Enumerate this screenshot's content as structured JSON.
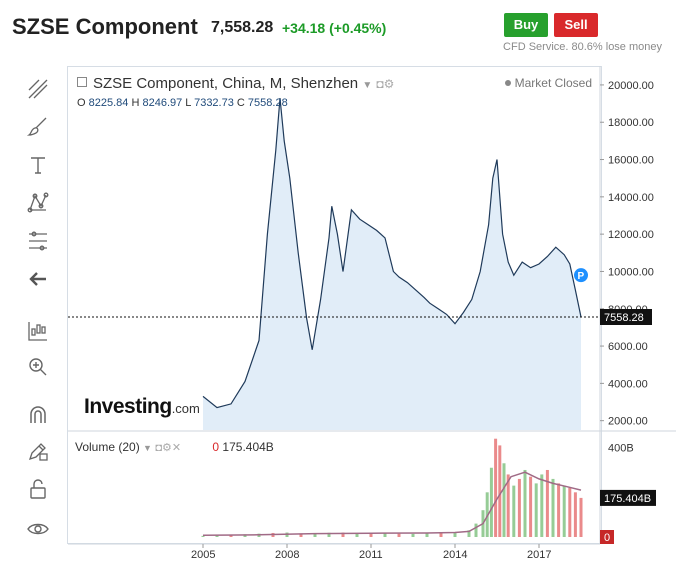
{
  "header": {
    "instrument_name": "SZSE Component",
    "price": "7,558.28",
    "change": "+34.18 (+0.45%)",
    "buy_label": "Buy",
    "sell_label": "Sell",
    "cfd_note": "CFD Service. 80.6% lose money"
  },
  "chart_header": {
    "title": "SZSE Component, China, M, Shenzhen",
    "market_status": "Market Closed",
    "open_label": "O",
    "open": "8225.84",
    "high_label": "H",
    "high": "8246.97",
    "low_label": "L",
    "low": "7332.73",
    "close_label": "C",
    "close": "7558.28"
  },
  "volume_header": {
    "label": "Volume (20)",
    "value_zero": "0",
    "value": "175.404B"
  },
  "toolbar_icons": [
    "crosshair-lines-icon",
    "brush-icon",
    "text-icon",
    "pattern-icon",
    "fib-levels-icon",
    "back-arrow-icon",
    "indicators-icon",
    "zoom-icon",
    "magnet-icon",
    "edit-lock-icon",
    "unlock-icon",
    "eye-icon"
  ],
  "logo_text": "Investing",
  "logo_suffix": ".com",
  "colors": {
    "line": "#1f3a5a",
    "area": "#dceaf7",
    "up": "#3fa33f",
    "down": "#d9292b",
    "buy": "#27a02d",
    "sell": "#d9292b",
    "badge": "#1e90ff"
  },
  "chart_data": [
    {
      "type": "area",
      "x_tick_labels": [
        "2005",
        "2008",
        "2011",
        "2014",
        "2017"
      ],
      "y_tick_labels": [
        "2000.00",
        "4000.00",
        "6000.00",
        "8000.00",
        "10000.00",
        "12000.00",
        "14000.00",
        "16000.00",
        "18000.00",
        "20000.00"
      ],
      "ylim": [
        1500,
        20800
      ],
      "xlim": [
        2005.9,
        2018.5
      ],
      "last_value": 7558.28,
      "last_value_label": "7558.28",
      "badge": "P",
      "x": [
        2005.0,
        2005.5,
        2006.0,
        2006.5,
        2007.0,
        2007.3,
        2007.6,
        2007.75,
        2007.9,
        2008.1,
        2008.4,
        2008.7,
        2008.9,
        2009.2,
        2009.5,
        2009.6,
        2009.8,
        2010.0,
        2010.3,
        2010.6,
        2010.9,
        2011.2,
        2011.5,
        2011.8,
        2012.0,
        2012.3,
        2012.6,
        2012.9,
        2013.1,
        2013.4,
        2013.7,
        2014.0,
        2014.3,
        2014.6,
        2014.9,
        2015.2,
        2015.35,
        2015.5,
        2015.7,
        2015.9,
        2016.1,
        2016.4,
        2016.7,
        2017.0,
        2017.3,
        2017.6,
        2017.9,
        2018.1,
        2018.3,
        2018.5
      ],
      "values": [
        3300,
        2700,
        2900,
        4100,
        6300,
        12000,
        16500,
        19300,
        17000,
        15000,
        11000,
        7500,
        5800,
        8500,
        11800,
        13500,
        12000,
        10000,
        13300,
        12800,
        12500,
        12200,
        11800,
        10000,
        9700,
        9400,
        9000,
        8600,
        8300,
        8000,
        7700,
        7200,
        7800,
        8500,
        10000,
        12500,
        15000,
        16000,
        12000,
        10500,
        9800,
        10500,
        10200,
        10400,
        10800,
        11300,
        10900,
        10400,
        9000,
        7558
      ]
    },
    {
      "type": "bar",
      "name": "Volume (20)",
      "ylabels": [
        "400B"
      ],
      "ylim": [
        0,
        470
      ],
      "last_value_label": "175.404B",
      "zero_label": "0",
      "x": [
        2005.0,
        2005.5,
        2006.0,
        2006.5,
        2007.0,
        2007.5,
        2008.0,
        2008.5,
        2009.0,
        2009.5,
        2010.0,
        2010.5,
        2011.0,
        2011.5,
        2012.0,
        2012.5,
        2013.0,
        2013.5,
        2014.0,
        2014.5,
        2014.75,
        2015.0,
        2015.15,
        2015.3,
        2015.45,
        2015.6,
        2015.75,
        2015.9,
        2016.1,
        2016.3,
        2016.5,
        2016.7,
        2016.9,
        2017.1,
        2017.3,
        2017.5,
        2017.7,
        2017.9,
        2018.1,
        2018.3,
        2018.5
      ],
      "values": [
        5,
        6,
        8,
        12,
        15,
        18,
        20,
        16,
        17,
        19,
        20,
        18,
        17,
        16,
        15,
        14,
        18,
        20,
        22,
        30,
        60,
        120,
        200,
        310,
        440,
        410,
        330,
        280,
        230,
        260,
        300,
        270,
        240,
        280,
        300,
        260,
        240,
        230,
        220,
        200,
        175
      ],
      "up": [
        true,
        true,
        false,
        true,
        true,
        false,
        true,
        false,
        true,
        true,
        false,
        true,
        false,
        true,
        false,
        true,
        true,
        false,
        true,
        true,
        true,
        true,
        true,
        true,
        false,
        false,
        true,
        false,
        true,
        false,
        true,
        false,
        true,
        true,
        false,
        true,
        false,
        true,
        false,
        false,
        false
      ],
      "ma_x": [
        2005.0,
        2007.0,
        2009.0,
        2011.0,
        2013.0,
        2014.0,
        2014.5,
        2015.0,
        2015.5,
        2016.0,
        2016.5,
        2017.0,
        2017.5,
        2018.0,
        2018.5
      ],
      "ma_values": [
        8,
        10,
        15,
        17,
        18,
        20,
        25,
        60,
        170,
        270,
        290,
        260,
        240,
        225,
        210
      ]
    }
  ]
}
